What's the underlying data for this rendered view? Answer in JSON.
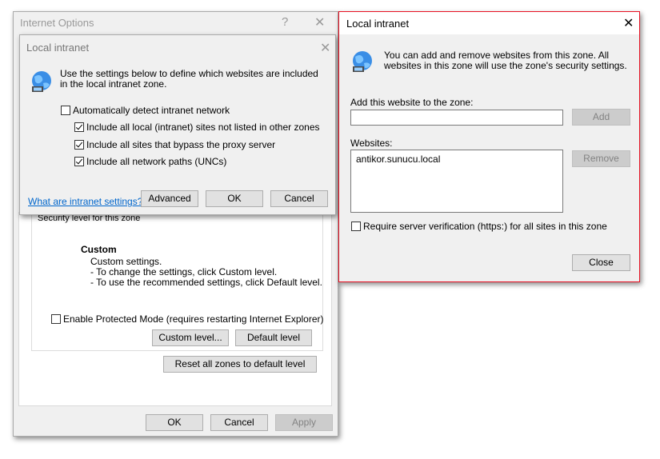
{
  "internet_options": {
    "title": "Internet Options",
    "help_glyph": "?",
    "close_glyph": "✕",
    "security_group": {
      "level_label": "Security level for this zone",
      "custom_title": "Custom",
      "custom_line1": "Custom settings.",
      "custom_line2": "- To change the settings, click Custom level.",
      "custom_line3": "- To use the recommended settings, click Default level."
    },
    "protected_mode_label": "Enable Protected Mode (requires restarting Internet Explorer)",
    "protected_mode_checked": false,
    "custom_level_label": "Custom level...",
    "default_level_label": "Default level",
    "reset_all_label": "Reset all zones to default level",
    "ok_label": "OK",
    "cancel_label": "Cancel",
    "apply_label": "Apply"
  },
  "local_intranet_small": {
    "title": "Local intranet",
    "close_glyph": "✕",
    "intro": "Use the settings below to define which websites are included in the local intranet zone.",
    "options": [
      {
        "label": "Automatically detect intranet network",
        "checked": false
      },
      {
        "label": "Include all local (intranet) sites not listed in other zones",
        "checked": true
      },
      {
        "label": "Include all sites that bypass the proxy server",
        "checked": true
      },
      {
        "label": "Include all network paths (UNCs)",
        "checked": true
      }
    ],
    "link_label": "What are intranet settings?",
    "advanced_label": "Advanced",
    "ok_label": "OK",
    "cancel_label": "Cancel"
  },
  "local_intranet_sites": {
    "title": "Local intranet",
    "close_glyph": "✕",
    "intro": "You can add and remove websites from this zone. All websites in this zone will use the zone's security settings.",
    "add_label": "Add this website to the zone:",
    "add_value": "",
    "add_button": "Add",
    "websites_label": "Websites:",
    "websites": [
      "antikor.sunucu.local"
    ],
    "remove_button": "Remove",
    "require_https_label": "Require server verification (https:) for all sites in this zone",
    "require_https_checked": false,
    "close_button": "Close"
  },
  "colors": {
    "dialog_bg": "#f0f0f0",
    "active_border": "#e81123",
    "link": "#0066cc"
  }
}
